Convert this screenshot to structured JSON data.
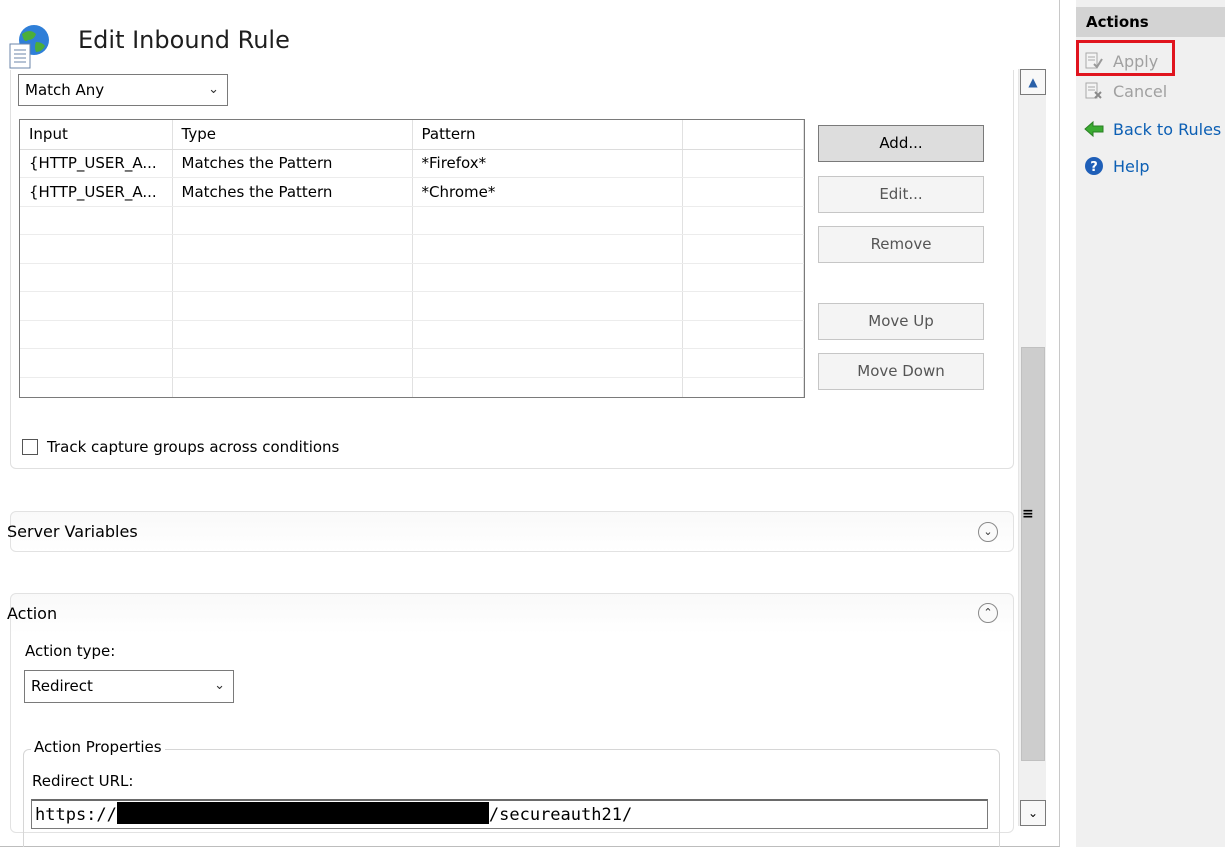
{
  "page": {
    "title": "Edit Inbound Rule"
  },
  "conditions": {
    "logical_grouping": "Match Any",
    "table": {
      "columns": [
        "Input",
        "Type",
        "Pattern",
        ""
      ],
      "rows": [
        [
          "{HTTP_USER_A...",
          "Matches the Pattern",
          "*Firefox*",
          ""
        ],
        [
          "{HTTP_USER_A...",
          "Matches the Pattern",
          "*Chrome*",
          ""
        ]
      ]
    },
    "buttons": {
      "add": "Add...",
      "edit": "Edit...",
      "remove": "Remove",
      "move_up": "Move Up",
      "move_down": "Move Down"
    },
    "track_capture_groups": {
      "label": "Track capture groups across conditions",
      "checked": false
    }
  },
  "server_variables": {
    "title": "Server Variables",
    "collapsed": true
  },
  "action": {
    "title": "Action",
    "collapsed": false,
    "action_type_label": "Action type:",
    "action_type_value": "Redirect",
    "properties_legend": "Action Properties",
    "redirect_url_label": "Redirect URL:",
    "redirect_url_prefix": "https://",
    "redirect_url_suffix": "/secureauth21/"
  },
  "actions_pane": {
    "header": "Actions",
    "items": [
      {
        "label": "Apply",
        "icon": "apply-icon",
        "enabled": false,
        "highlighted": true
      },
      {
        "label": "Cancel",
        "icon": "cancel-icon",
        "enabled": false
      },
      {
        "label": "Back to Rules",
        "icon": "back-arrow-icon",
        "enabled": true
      },
      {
        "label": "Help",
        "icon": "help-icon",
        "enabled": true
      }
    ]
  },
  "colors": {
    "link": "#0c5fb4",
    "highlight": "#e0141e",
    "pane_bg": "#f0f0f0"
  }
}
